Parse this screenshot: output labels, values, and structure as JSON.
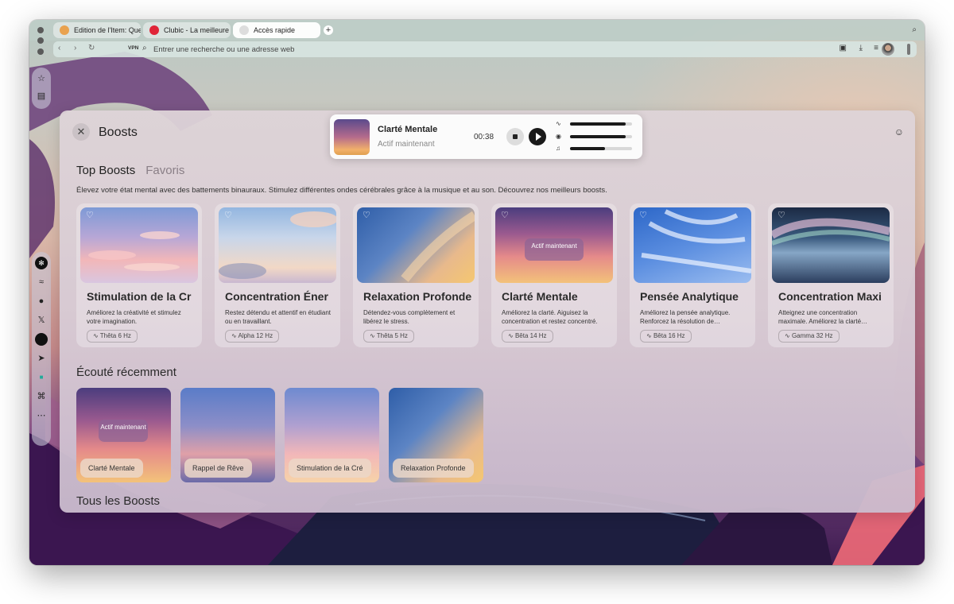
{
  "browser": {
    "tabs": [
      {
        "label": "Edition de l'Item: Que",
        "favicon_color": "#e9a24f"
      },
      {
        "label": "Clubic - La meilleure sc",
        "favicon_color": "#e02538"
      },
      {
        "label": "Accès rapide",
        "favicon_color": "#dddddd"
      }
    ],
    "new_tab": "+",
    "address_placeholder": "Entrer une recherche ou une adresse web",
    "vpn_label": "VPN"
  },
  "panel": {
    "title": "Boosts",
    "tabs": [
      "Top Boosts",
      "Favoris"
    ],
    "description": "Élevez votre état mental avec des battements binauraux. Stimulez différentes ondes cérébrales grâce à la musique et au son. Découvrez nos meilleurs boosts.",
    "active_label": "Actif maintenant",
    "top_boosts": [
      {
        "title": "Stimulation de la Cr",
        "desc": "Améliorez la créativité et stimulez votre imagination.",
        "hz": "Thêta 6 Hz",
        "active": false
      },
      {
        "title": "Concentration Éner",
        "desc": "Restez détendu et attentif en étudiant ou en travaillant.",
        "hz": "Alpha 12 Hz",
        "active": false
      },
      {
        "title": "Relaxation Profonde",
        "desc": "Détendez-vous complètement et libérez le stress.",
        "hz": "Thêta 5 Hz",
        "active": false
      },
      {
        "title": "Clarté Mentale",
        "desc": "Améliorez la clarté. Aiguisez la concentration et restez concentré.",
        "hz": "Bêta 14 Hz",
        "active": true
      },
      {
        "title": "Pensée Analytique",
        "desc": "Améliorez la pensée analytique. Renforcez la résolution de…",
        "hz": "Bêta 16 Hz",
        "active": false
      },
      {
        "title": "Concentration Maxi",
        "desc": "Atteignez une concentration maximale. Améliorez la clarté…",
        "hz": "Gamma 32 Hz",
        "active": false
      }
    ],
    "recent_title": "Écouté récemment",
    "recent": [
      {
        "label": "Clarté Mentale",
        "active": true
      },
      {
        "label": "Rappel de Rêve",
        "active": false
      },
      {
        "label": "Stimulation de la Cré",
        "active": false
      },
      {
        "label": "Relaxation Profonde",
        "active": false
      }
    ],
    "all_title": "Tous les Boosts"
  },
  "player": {
    "title": "Clarté Mentale",
    "subtitle": "Actif maintenant",
    "time": "00:38",
    "sliders": [
      {
        "icon": "waveform-icon",
        "level": 0.9
      },
      {
        "icon": "target-icon",
        "level": 0.9
      },
      {
        "icon": "music-note-icon",
        "level": 0.56
      }
    ]
  }
}
